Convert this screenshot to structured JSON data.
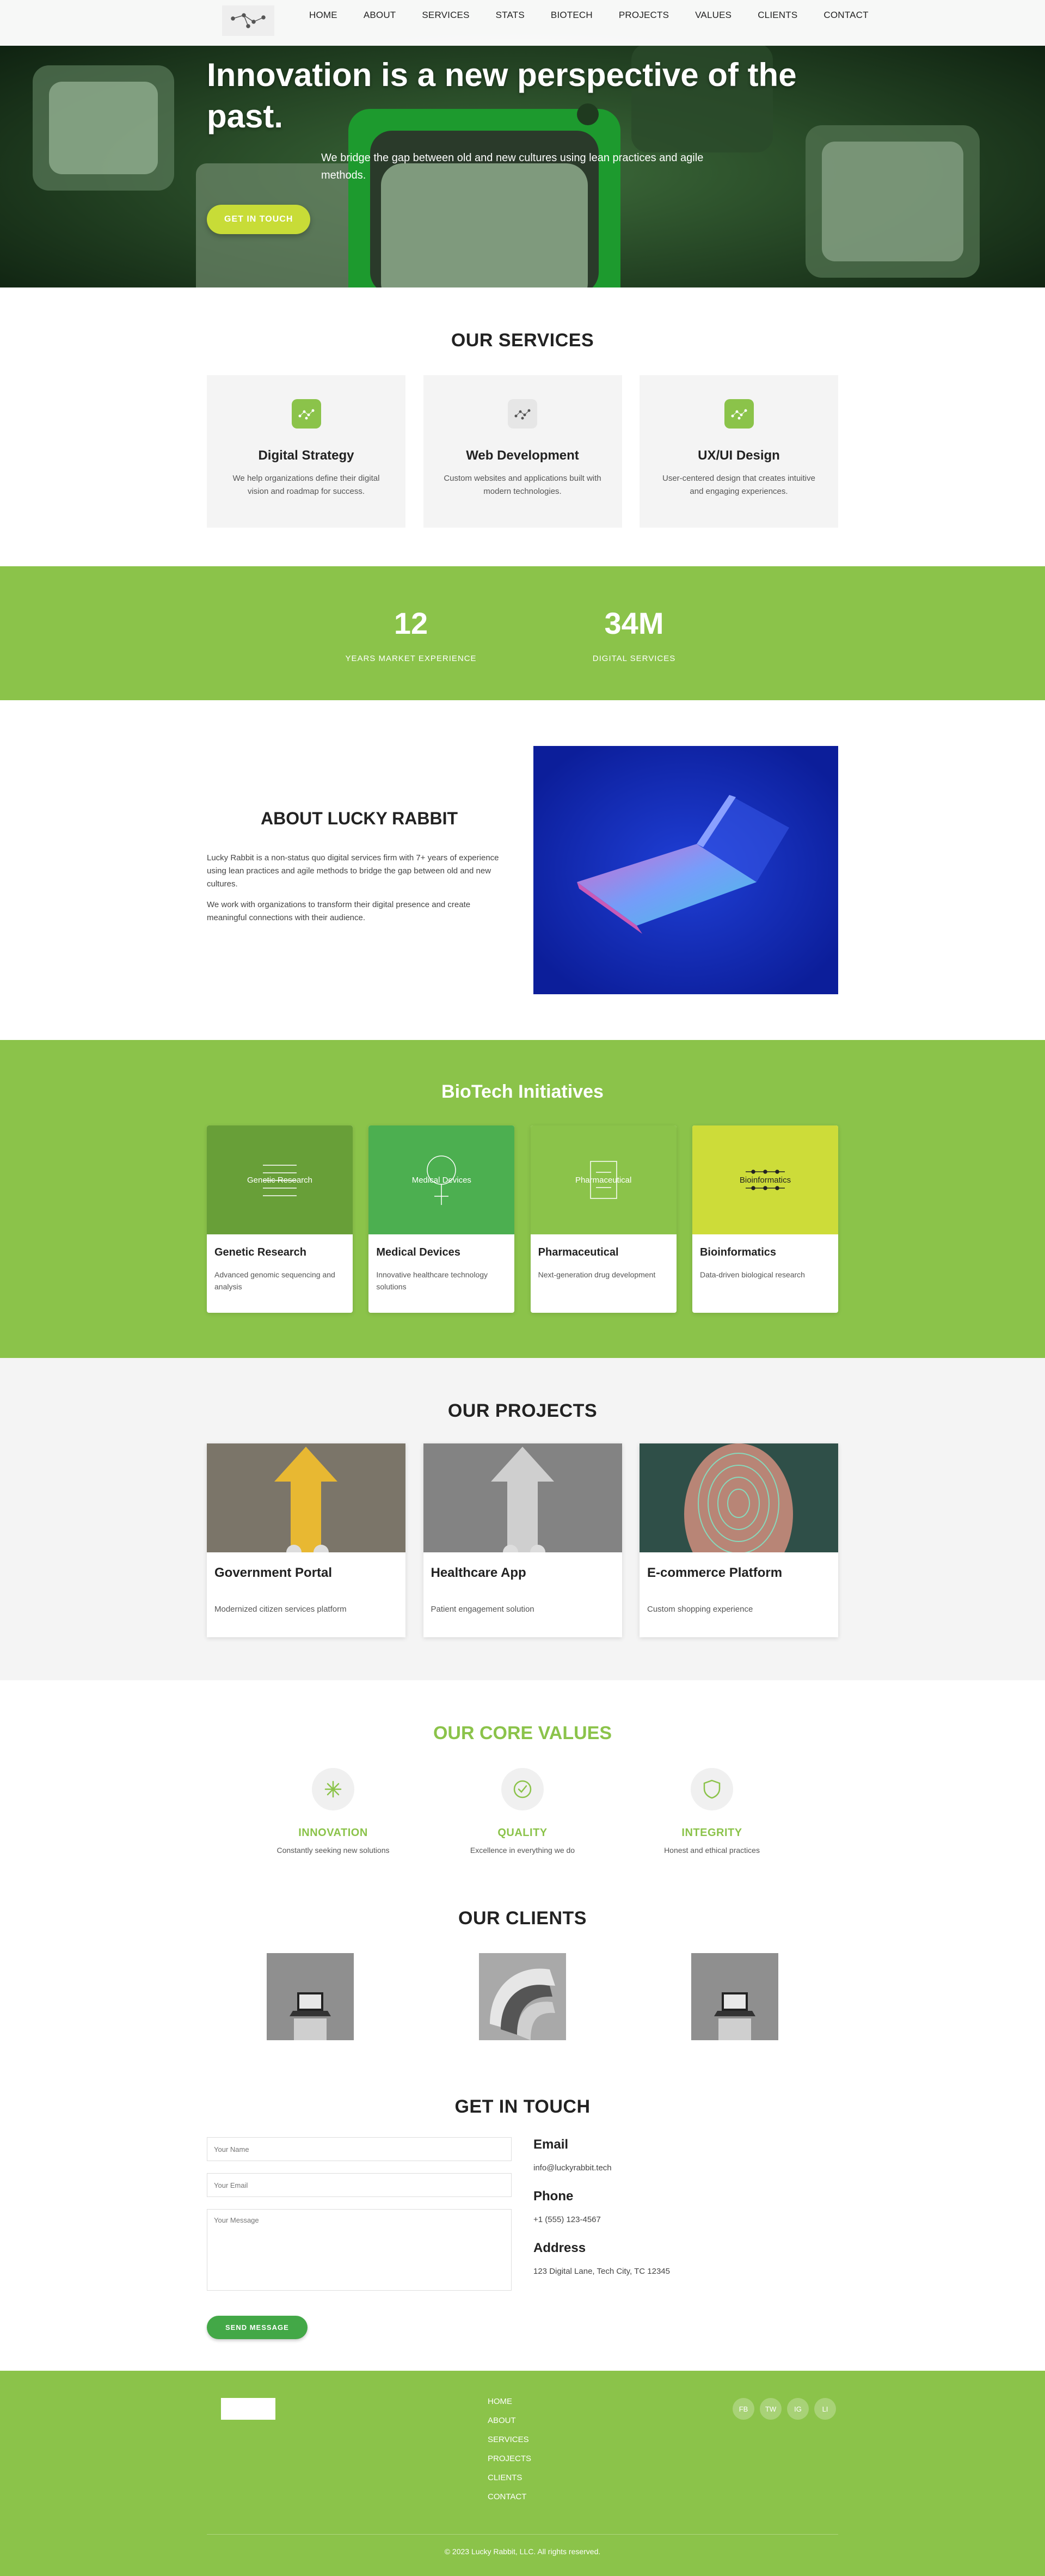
{
  "nav": {
    "items": [
      "HOME",
      "ABOUT",
      "SERVICES",
      "STATS",
      "BIOTECH",
      "PROJECTS",
      "VALUES",
      "CLIENTS",
      "CONTACT"
    ]
  },
  "hero": {
    "title": "Innovation is a new perspective of the past.",
    "subtitle": "We bridge the gap between old and new cultures using lean practices and agile methods.",
    "cta": "GET IN TOUCH"
  },
  "services": {
    "title": "OUR SERVICES",
    "items": [
      {
        "title": "Digital Strategy",
        "desc": "We help organizations define their digital vision and roadmap for success.",
        "icon": "network-icon",
        "icon_color": "#8bc34a"
      },
      {
        "title": "Web Development",
        "desc": "Custom websites and applications built with modern technologies.",
        "icon": "network-icon",
        "icon_color": "#e6e6e6"
      },
      {
        "title": "UX/UI Design",
        "desc": "User-centered design that creates intuitive and engaging experiences.",
        "icon": "network-icon",
        "icon_color": "#8bc34a"
      }
    ]
  },
  "stats": [
    {
      "value": "12",
      "label": "YEARS MARKET EXPERIENCE"
    },
    {
      "value": "34M",
      "label": "DIGITAL SERVICES"
    }
  ],
  "about": {
    "title": "ABOUT LUCKY RABBIT",
    "p1": "Lucky Rabbit is a non-status quo digital services firm with 7+ years of experience using lean practices and agile methods to bridge the gap between old and new cultures.",
    "p2": "We work with organizations to transform their digital presence and create meaningful connections with their audience."
  },
  "biotech": {
    "title": "BioTech Initiatives",
    "items": [
      {
        "label": "Genetic Research",
        "title": "Genetic Research",
        "desc": "Advanced genomic sequencing and analysis",
        "color": "#689f38"
      },
      {
        "label": "Medical Devices",
        "title": "Medical Devices",
        "desc": "Innovative healthcare technology solutions",
        "color": "#4caf50"
      },
      {
        "label": "Pharmaceutical",
        "title": "Pharmaceutical",
        "desc": "Next-generation drug development",
        "color": "#8bc34a"
      },
      {
        "label": "Bioinformatics",
        "title": "Bioinformatics",
        "desc": "Data-driven biological research",
        "color": "#cddc39"
      }
    ]
  },
  "projects": {
    "title": "OUR PROJECTS",
    "items": [
      {
        "title": "Government Portal",
        "desc": "Modernized citizen services platform"
      },
      {
        "title": "Healthcare App",
        "desc": "Patient engagement solution"
      },
      {
        "title": "E-commerce Platform",
        "desc": "Custom shopping experience"
      }
    ]
  },
  "values": {
    "title": "OUR CORE VALUES",
    "items": [
      {
        "title": "INNOVATION",
        "desc": "Constantly seeking new solutions",
        "icon": "sparkle-icon"
      },
      {
        "title": "QUALITY",
        "desc": "Excellence in everything we do",
        "icon": "check-circle-icon"
      },
      {
        "title": "INTEGRITY",
        "desc": "Honest and ethical practices",
        "icon": "shield-icon"
      }
    ]
  },
  "clients": {
    "title": "OUR CLIENTS"
  },
  "contact": {
    "title": "GET IN TOUCH",
    "name_placeholder": "Your Name",
    "email_placeholder": "Your Email",
    "message_placeholder": "Your Message",
    "submit": "SEND MESSAGE",
    "email_label": "Email",
    "email_value": "info@luckyrabbit.tech",
    "phone_label": "Phone",
    "phone_value": "+1 (555) 123-4567",
    "address_label": "Address",
    "address_value": "123 Digital Lane, Tech City, TC 12345"
  },
  "footer": {
    "links": [
      "HOME",
      "ABOUT",
      "SERVICES",
      "PROJECTS",
      "CLIENTS",
      "CONTACT"
    ],
    "social": [
      "FB",
      "TW",
      "IG",
      "LI"
    ],
    "copyright": "© 2023 Lucky Rabbit, LLC. All rights reserved."
  },
  "colors": {
    "brand_green": "#8bc34a",
    "dark_green": "#43a847",
    "lime": "#cddc39",
    "hero_button": "#c8dc37"
  }
}
